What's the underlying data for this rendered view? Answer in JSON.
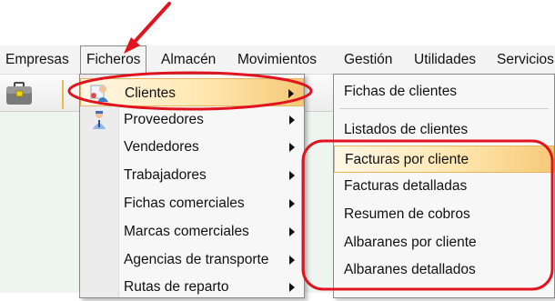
{
  "menubar": {
    "items": [
      "Empresas",
      "Ficheros",
      "Almacén",
      "Movimientos",
      "Gestión",
      "Utilidades",
      "Servicios"
    ],
    "open_item": "Ficheros"
  },
  "ficheros_menu": {
    "items": [
      {
        "label": "Clientes",
        "icon": "clients-icon",
        "submenu": true
      },
      {
        "label": "Proveedores",
        "icon": "suppliers-icon",
        "submenu": true
      },
      {
        "label": "Vendedores",
        "submenu": true
      },
      {
        "label": "Trabajadores",
        "submenu": true
      },
      {
        "label": "Fichas comerciales",
        "submenu": true
      },
      {
        "label": "Marcas comerciales",
        "submenu": true
      },
      {
        "label": "Agencias de transporte",
        "submenu": true
      },
      {
        "label": "Rutas de reparto",
        "submenu": true
      }
    ],
    "highlighted": "Clientes"
  },
  "clientes_submenu": {
    "items": [
      "Fichas de clientes",
      "Listados de clientes",
      "Facturas por cliente",
      "Facturas detalladas",
      "Resumen de cobros",
      "Albaranes por cliente",
      "Albaranes detallados"
    ],
    "highlighted": "Facturas por cliente"
  },
  "colors": {
    "highlight": "#f6c978",
    "annotation": "#e0141e",
    "workspace": "#eef5f0"
  }
}
